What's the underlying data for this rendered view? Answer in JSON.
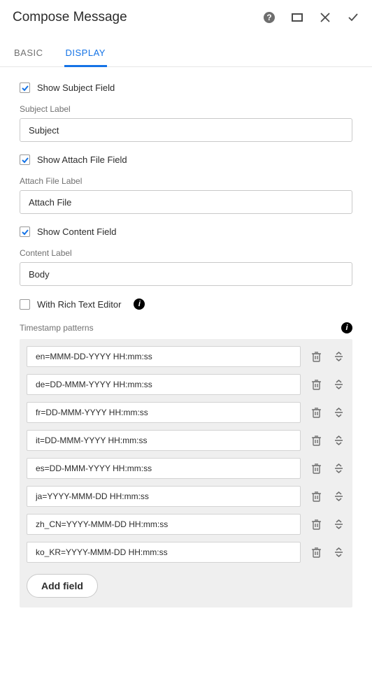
{
  "header": {
    "title": "Compose Message"
  },
  "tabs": {
    "basic": "BASIC",
    "display": "DISPLAY"
  },
  "fields": {
    "show_subject_label": "Show Subject Field",
    "subject_label_title": "Subject Label",
    "subject_label_value": "Subject",
    "show_attach_label": "Show Attach File Field",
    "attach_label_title": "Attach File Label",
    "attach_label_value": "Attach File",
    "show_content_label": "Show Content Field",
    "content_label_title": "Content Label",
    "content_label_value": "Body",
    "rich_text_label": "With Rich Text Editor"
  },
  "timestamp": {
    "title": "Timestamp patterns",
    "add_field": "Add field",
    "patterns": [
      "en=MMM-DD-YYYY HH:mm:ss",
      "de=DD-MMM-YYYY HH:mm:ss",
      "fr=DD-MMM-YYYY HH:mm:ss",
      "it=DD-MMM-YYYY HH:mm:ss",
      "es=DD-MMM-YYYY HH:mm:ss",
      "ja=YYYY-MMM-DD HH:mm:ss",
      "zh_CN=YYYY-MMM-DD HH:mm:ss",
      "ko_KR=YYYY-MMM-DD HH:mm:ss"
    ]
  }
}
